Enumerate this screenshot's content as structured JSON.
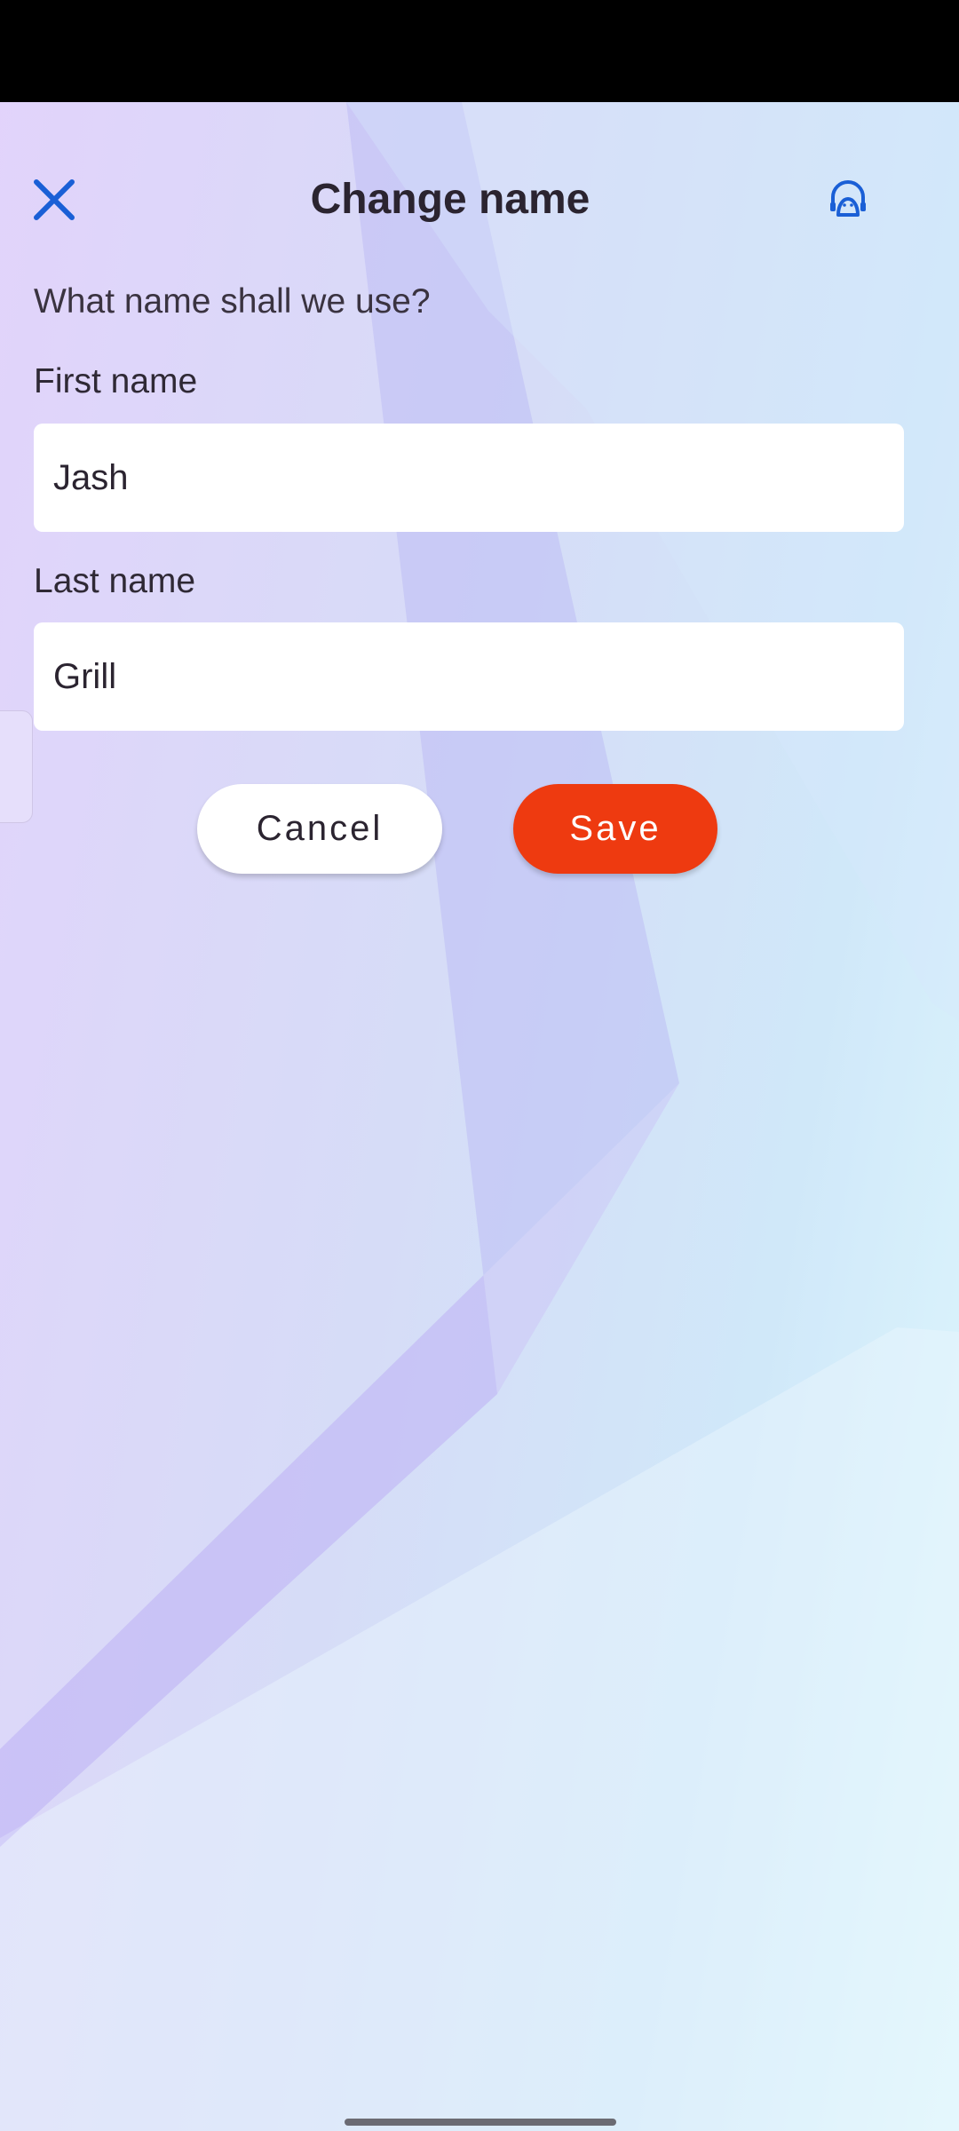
{
  "header": {
    "title": "Change name",
    "close_icon": "close-icon",
    "support_icon": "headset-support-icon"
  },
  "form": {
    "prompt": "What name shall we use?",
    "first_name": {
      "label": "First name",
      "value": "Jash"
    },
    "last_name": {
      "label": "Last name",
      "value": "Grill"
    }
  },
  "actions": {
    "cancel_label": "Cancel",
    "save_label": "Save"
  },
  "colors": {
    "accent_blue": "#1a5fd6",
    "save_orange": "#ee3a10",
    "title_text": "#2b2430"
  }
}
